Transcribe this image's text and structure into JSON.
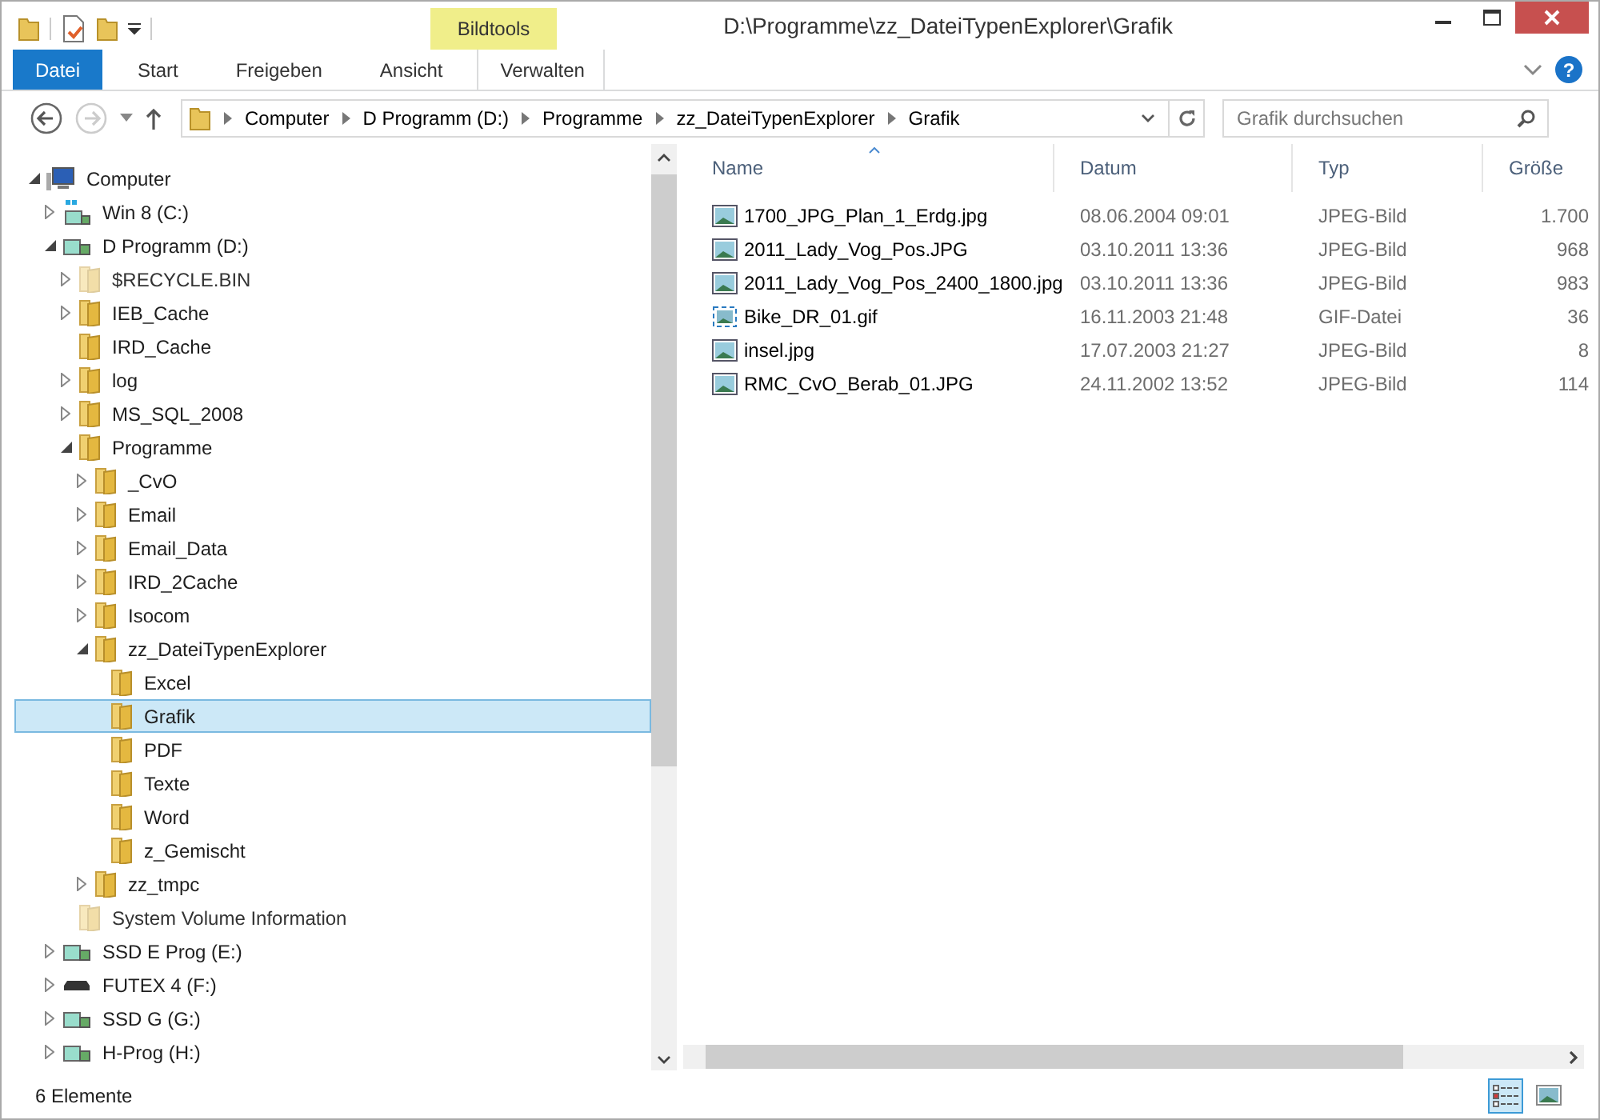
{
  "window": {
    "title": "D:\\Programme\\zz_DateiTypenExplorer\\Grafik"
  },
  "context_tab": {
    "label": "Bildtools"
  },
  "ribbon_tabs": [
    {
      "label": "Datei",
      "kind": "file",
      "selected": false
    },
    {
      "label": "Start",
      "kind": "tab",
      "selected": false
    },
    {
      "label": "Freigeben",
      "kind": "tab",
      "selected": false
    },
    {
      "label": "Ansicht",
      "kind": "tab",
      "selected": false
    },
    {
      "label": "Verwalten",
      "kind": "context",
      "selected": false
    }
  ],
  "address": {
    "crumbs": [
      "Computer",
      "D Programm (D:)",
      "Programme",
      "zz_DateiTypenExplorer",
      "Grafik"
    ]
  },
  "search": {
    "placeholder": "Grafik durchsuchen"
  },
  "tree": [
    {
      "label": "Computer",
      "kind": "computer",
      "expandable": true,
      "expanded": true,
      "selected": false,
      "hidden": false,
      "children": [
        {
          "label": "Win 8 (C:)",
          "kind": "system-drive",
          "expandable": true,
          "expanded": false,
          "selected": false,
          "hidden": false
        },
        {
          "label": "D Programm (D:)",
          "kind": "drive",
          "expandable": true,
          "expanded": true,
          "selected": false,
          "hidden": false,
          "children": [
            {
              "label": "$RECYCLE.BIN",
              "kind": "folder",
              "expandable": true,
              "expanded": false,
              "selected": false,
              "hidden": true
            },
            {
              "label": "IEB_Cache",
              "kind": "folder",
              "expandable": true,
              "expanded": false,
              "selected": false,
              "hidden": false
            },
            {
              "label": "IRD_Cache",
              "kind": "folder",
              "expandable": false,
              "expanded": false,
              "selected": false,
              "hidden": false
            },
            {
              "label": "log",
              "kind": "folder",
              "expandable": true,
              "expanded": false,
              "selected": false,
              "hidden": false
            },
            {
              "label": "MS_SQL_2008",
              "kind": "folder",
              "expandable": true,
              "expanded": false,
              "selected": false,
              "hidden": false
            },
            {
              "label": "Programme",
              "kind": "folder",
              "expandable": true,
              "expanded": true,
              "selected": false,
              "hidden": false,
              "children": [
                {
                  "label": "_CvO",
                  "kind": "folder",
                  "expandable": true,
                  "expanded": false,
                  "selected": false,
                  "hidden": false
                },
                {
                  "label": "Email",
                  "kind": "folder",
                  "expandable": true,
                  "expanded": false,
                  "selected": false,
                  "hidden": false
                },
                {
                  "label": "Email_Data",
                  "kind": "folder",
                  "expandable": true,
                  "expanded": false,
                  "selected": false,
                  "hidden": false
                },
                {
                  "label": "IRD_2Cache",
                  "kind": "folder",
                  "expandable": true,
                  "expanded": false,
                  "selected": false,
                  "hidden": false
                },
                {
                  "label": "Isocom",
                  "kind": "folder",
                  "expandable": true,
                  "expanded": false,
                  "selected": false,
                  "hidden": false
                },
                {
                  "label": "zz_DateiTypenExplorer",
                  "kind": "folder",
                  "expandable": true,
                  "expanded": true,
                  "selected": false,
                  "hidden": false,
                  "children": [
                    {
                      "label": "Excel",
                      "kind": "folder",
                      "expandable": false,
                      "expanded": false,
                      "selected": false,
                      "hidden": false
                    },
                    {
                      "label": "Grafik",
                      "kind": "folder",
                      "expandable": false,
                      "expanded": false,
                      "selected": true,
                      "hidden": false
                    },
                    {
                      "label": "PDF",
                      "kind": "folder",
                      "expandable": false,
                      "expanded": false,
                      "selected": false,
                      "hidden": false
                    },
                    {
                      "label": "Texte",
                      "kind": "folder",
                      "expandable": false,
                      "expanded": false,
                      "selected": false,
                      "hidden": false
                    },
                    {
                      "label": "Word",
                      "kind": "folder",
                      "expandable": false,
                      "expanded": false,
                      "selected": false,
                      "hidden": false
                    },
                    {
                      "label": "z_Gemischt",
                      "kind": "folder",
                      "expandable": false,
                      "expanded": false,
                      "selected": false,
                      "hidden": false
                    }
                  ]
                },
                {
                  "label": "zz_tmpc",
                  "kind": "folder",
                  "expandable": true,
                  "expanded": false,
                  "selected": false,
                  "hidden": false
                }
              ]
            },
            {
              "label": "System Volume Information",
              "kind": "folder",
              "expandable": false,
              "expanded": false,
              "selected": false,
              "hidden": true
            }
          ]
        },
        {
          "label": "SSD E Prog (E:)",
          "kind": "drive",
          "expandable": true,
          "expanded": false,
          "selected": false,
          "hidden": false
        },
        {
          "label": "FUTEX 4 (F:)",
          "kind": "usb",
          "expandable": true,
          "expanded": false,
          "selected": false,
          "hidden": false
        },
        {
          "label": "SSD G (G:)",
          "kind": "drive",
          "expandable": true,
          "expanded": false,
          "selected": false,
          "hidden": false
        },
        {
          "label": "H-Prog (H:)",
          "kind": "drive",
          "expandable": true,
          "expanded": false,
          "selected": false,
          "hidden": false
        }
      ]
    }
  ],
  "files": {
    "columns": [
      {
        "label": "Name",
        "sorted": true
      },
      {
        "label": "Datum",
        "sorted": false
      },
      {
        "label": "Typ",
        "sorted": false
      },
      {
        "label": "Größe",
        "sorted": false
      }
    ],
    "rows": [
      {
        "name": "1700_JPG_Plan_1_Erdg.jpg",
        "date": "08.06.2004 09:01",
        "type": "JPEG-Bild",
        "size": "1.700",
        "kind": "jpeg"
      },
      {
        "name": "2011_Lady_Vog_Pos.JPG",
        "date": "03.10.2011 13:36",
        "type": "JPEG-Bild",
        "size": "968",
        "kind": "jpeg"
      },
      {
        "name": "2011_Lady_Vog_Pos_2400_1800.jpg",
        "date": "03.10.2011 13:36",
        "type": "JPEG-Bild",
        "size": "983",
        "kind": "jpeg"
      },
      {
        "name": "Bike_DR_01.gif",
        "date": "16.11.2003 21:48",
        "type": "GIF-Datei",
        "size": "36",
        "kind": "gif"
      },
      {
        "name": "insel.jpg",
        "date": "17.07.2003 21:27",
        "type": "JPEG-Bild",
        "size": "8",
        "kind": "jpeg"
      },
      {
        "name": "RMC_CvO_Berab_01.JPG",
        "date": "24.11.2002 13:52",
        "type": "JPEG-Bild",
        "size": "114",
        "kind": "jpeg"
      }
    ]
  },
  "status_bar": {
    "count": "6 Elemente"
  },
  "help": {
    "label": "?"
  },
  "view_buttons": [
    {
      "kind": "details",
      "selected": true
    },
    {
      "kind": "large-icons",
      "selected": false
    }
  ]
}
